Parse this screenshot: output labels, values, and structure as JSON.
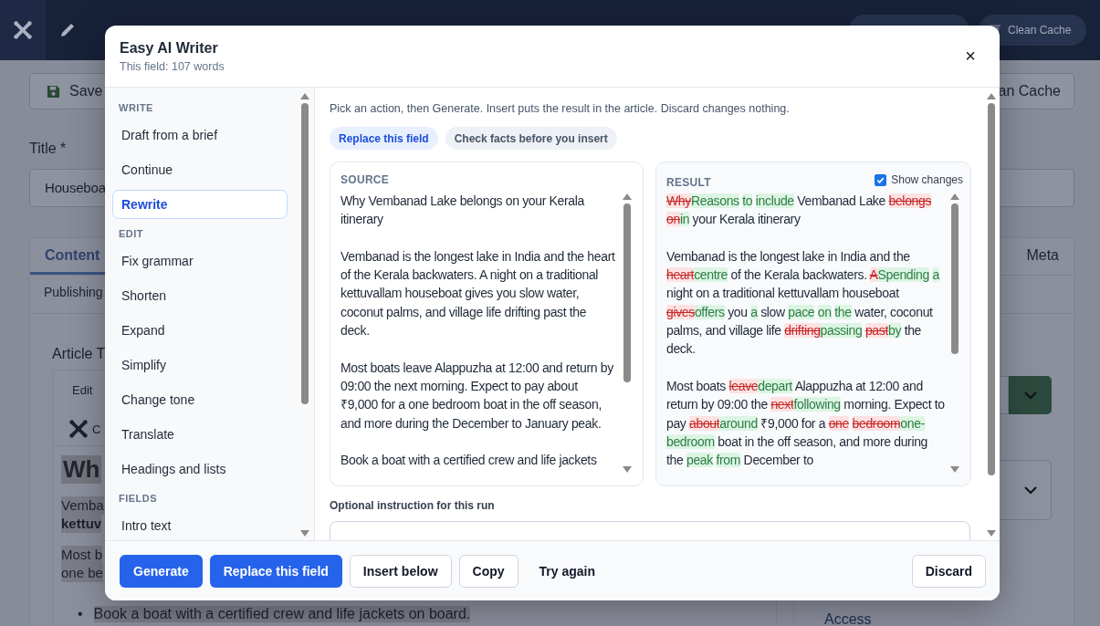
{
  "header": {
    "cache_button": "Clean Cache"
  },
  "toolbar": {
    "save": "Save",
    "clean_cache": "an Cache"
  },
  "form": {
    "title_label": "Title *",
    "title_value": "Houseboa"
  },
  "tabs_row_1": [
    {
      "label": "Content",
      "selected": true
    },
    {
      "label": "Meta",
      "selected": false
    }
  ],
  "tabs_row_2": [
    {
      "label": "Publishing",
      "selected": false
    }
  ],
  "editor": {
    "label": "Article T",
    "menu": "Edit",
    "plugin": "C",
    "heading": "Wh",
    "paragraphs": [
      [
        "Vemba",
        "**kettuv**"
      ],
      [
        "Most b",
        "one be"
      ]
    ],
    "bullets": [
      {
        "marker": "•",
        "text": "Book a boat with a certified crew and life jackets on board."
      }
    ]
  },
  "side": {
    "access": "Access"
  },
  "dialog": {
    "title": "Easy AI Writer",
    "subtitle": "This field: 107 words",
    "close": "×",
    "menu": [
      {
        "heading": "WRITE",
        "items": [
          {
            "label": "Draft from a brief",
            "selected": false
          },
          {
            "label": "Continue",
            "selected": false
          },
          {
            "label": "Rewrite",
            "selected": true
          }
        ]
      },
      {
        "heading": "EDIT",
        "items": [
          {
            "label": "Fix grammar",
            "selected": false
          },
          {
            "label": "Shorten",
            "selected": false
          },
          {
            "label": "Expand",
            "selected": false
          },
          {
            "label": "Simplify",
            "selected": false
          },
          {
            "label": "Change tone",
            "selected": false
          },
          {
            "label": "Translate",
            "selected": false
          },
          {
            "label": "Headings and lists",
            "selected": false
          }
        ]
      },
      {
        "heading": "FIELDS",
        "items": [
          {
            "label": "Intro text",
            "selected": false
          }
        ]
      }
    ],
    "hint": "Pick an action, then Generate. Insert puts the result in the article. Discard changes nothing.",
    "modes": [
      {
        "label": "Replace this field",
        "selected": true
      },
      {
        "label": "Check facts before you insert",
        "selected": false
      }
    ],
    "source": {
      "label": "SOURCE",
      "paragraphs": [
        "Why Vembanad Lake belongs on your Kerala itinerary",
        "Vembanad is the longest lake in India and the heart of the Kerala backwaters. A night on a traditional kettuvallam houseboat gives you slow water, coconut palms, and village life drifting past the deck.",
        "Most boats leave Alappuzha at 12:00 and return by 09:00 the next morning. Expect to pay about ₹9,000 for a one bedroom boat in the off season, and more during the December to January peak.",
        "Book a boat with a certified crew and life jackets"
      ]
    },
    "result": {
      "label": "RESULT",
      "show_changes": {
        "label": "Show changes",
        "checked": true
      },
      "paragraphs": [
        [
          {
            "kind": "del",
            "text": "Why"
          },
          {
            "kind": "ins",
            "text": "Reasons to include"
          },
          {
            "kind": "same",
            "text": " Vembanad Lake "
          },
          {
            "kind": "del",
            "text": "belongs on"
          },
          {
            "kind": "ins",
            "text": "in"
          },
          {
            "kind": "same",
            "text": " your Kerala itinerary"
          }
        ],
        [
          {
            "kind": "same",
            "text": "Vembanad is the longest lake in India and the "
          },
          {
            "kind": "del",
            "text": "heart"
          },
          {
            "kind": "ins",
            "text": "centre"
          },
          {
            "kind": "same",
            "text": " of the Kerala backwaters. "
          },
          {
            "kind": "del",
            "text": "A"
          },
          {
            "kind": "ins",
            "text": "Spending a"
          },
          {
            "kind": "same",
            "text": " night on a traditional kettuvallam houseboat "
          },
          {
            "kind": "del",
            "text": "gives"
          },
          {
            "kind": "ins",
            "text": "offers"
          },
          {
            "kind": "same",
            "text": " you "
          },
          {
            "kind": "ins",
            "text": "a"
          },
          {
            "kind": "same",
            "text": " slow "
          },
          {
            "kind": "ins",
            "text": "pace on the"
          },
          {
            "kind": "same",
            "text": " water, coconut palms, and village life "
          },
          {
            "kind": "del",
            "text": "drifting"
          },
          {
            "kind": "ins",
            "text": "passing "
          },
          {
            "kind": "del",
            "text": "past"
          },
          {
            "kind": "ins",
            "text": "by"
          },
          {
            "kind": "same",
            "text": " the deck."
          }
        ],
        [
          {
            "kind": "same",
            "text": "Most boats "
          },
          {
            "kind": "del",
            "text": "leave"
          },
          {
            "kind": "ins",
            "text": "depart"
          },
          {
            "kind": "same",
            "text": " Alappuzha at 12:00 and return by 09:00 the "
          },
          {
            "kind": "del",
            "text": "next"
          },
          {
            "kind": "ins",
            "text": "following"
          },
          {
            "kind": "same",
            "text": " morning. Expect to pay "
          },
          {
            "kind": "del",
            "text": "about"
          },
          {
            "kind": "ins",
            "text": "around"
          },
          {
            "kind": "same",
            "text": " ₹9,000 for a "
          },
          {
            "kind": "del",
            "text": "one bedroom"
          },
          {
            "kind": "ins",
            "text": "one-bedroom"
          },
          {
            "kind": "same",
            "text": " boat in the off season, and more during the "
          },
          {
            "kind": "ins",
            "text": "peak from"
          },
          {
            "kind": "same",
            "text": " December to"
          }
        ]
      ]
    },
    "instruction": {
      "label": "Optional instruction for this run"
    },
    "actions": [
      {
        "label": "Generate",
        "kind": "primary"
      },
      {
        "label": "Replace this field",
        "kind": "primary"
      },
      {
        "label": "Insert below",
        "kind": "outline"
      },
      {
        "label": "Copy",
        "kind": "outline"
      },
      {
        "label": "Try again",
        "kind": "text"
      }
    ],
    "dismiss": {
      "label": "Discard"
    }
  }
}
